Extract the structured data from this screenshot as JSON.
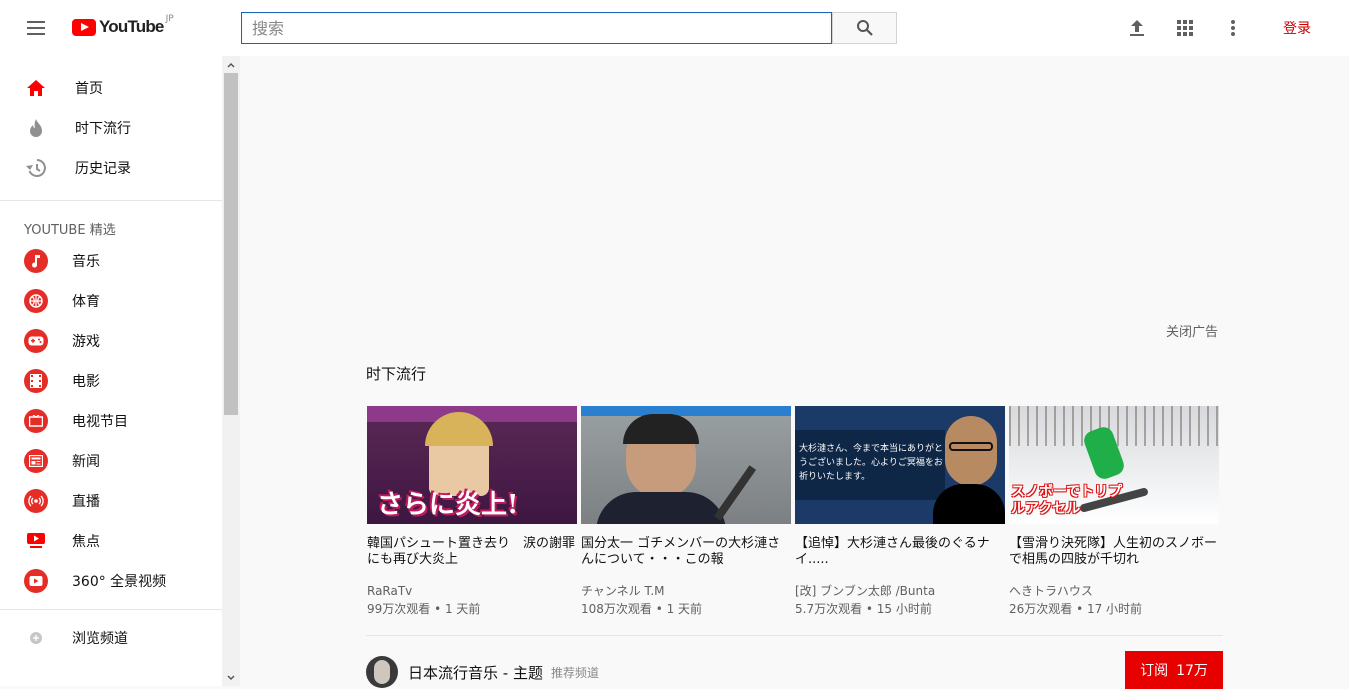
{
  "header": {
    "logo_text": "YouTube",
    "logo_region": "JP",
    "search_placeholder": "搜索",
    "signin_label": "登录"
  },
  "sidebar": {
    "main_items": [
      {
        "label": "首页",
        "icon": "home-icon",
        "active": true
      },
      {
        "label": "时下流行",
        "icon": "trending-icon"
      },
      {
        "label": "历史记录",
        "icon": "history-icon"
      }
    ],
    "featured_heading": "YOUTUBE 精选",
    "categories": [
      {
        "label": "音乐",
        "icon": "music-icon"
      },
      {
        "label": "体育",
        "icon": "sports-icon"
      },
      {
        "label": "游戏",
        "icon": "gaming-icon"
      },
      {
        "label": "电影",
        "icon": "movies-icon"
      },
      {
        "label": "电视节目",
        "icon": "tv-icon"
      },
      {
        "label": "新闻",
        "icon": "news-icon"
      },
      {
        "label": "直播",
        "icon": "live-icon"
      },
      {
        "label": "焦点",
        "icon": "spotlight-icon"
      },
      {
        "label": "360° 全景视频",
        "icon": "360-icon"
      }
    ],
    "browse_channels": "浏览频道"
  },
  "main": {
    "close_ad": "关闭广告",
    "shelf_title": "时下流行",
    "videos": [
      {
        "title": "韓国パシュート置き去り　涙の謝罪にも再び大炎上",
        "channel": "RaRaTv",
        "meta": "99万次观看 • 1 天前",
        "thumb_text": "さらに炎上!"
      },
      {
        "title": "国分太一 ゴチメンバーの大杉漣さんについて・・・この報",
        "channel": "チャンネル T.M",
        "meta": "108万次观看 • 1 天前",
        "thumb_text": ""
      },
      {
        "title": "【追悼】大杉漣さん最後のぐるナイ.....",
        "channel": "[改] ブンブン太郎 /Bunta",
        "meta": "5.7万次观看 • 15 小时前",
        "thumb_text": "大杉漣さん、今まで本当にありがとうございました。心よりご冥福をお祈りいたします。"
      },
      {
        "title": "【雪滑り決死隊】人生初のスノボーで相馬の四肢が千切れ",
        "channel": "へきトラハウス",
        "meta": "26万次观看 • 17 小时前",
        "thumb_text": "スノボーでトリプルアクセル"
      }
    ],
    "channel_shelf": {
      "name": "日本流行音乐 - 主题",
      "tag": "推荐频道",
      "subscribe_label": "订阅",
      "subscriber_count": "17万"
    }
  },
  "colors": {
    "brand": "#ff0000",
    "subscribe": "#e60000",
    "link_red": "#cc0000"
  }
}
